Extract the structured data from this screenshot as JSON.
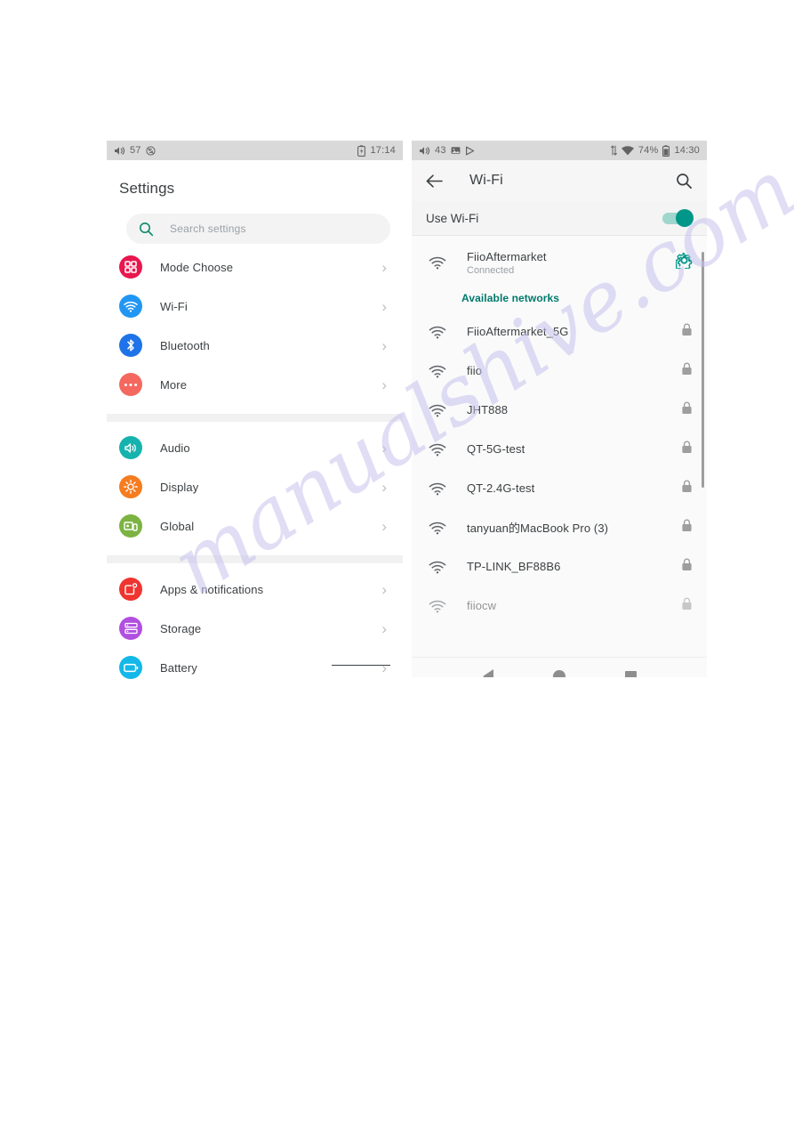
{
  "watermark": {
    "text": "manualshive.com"
  },
  "left_phone": {
    "status_bar": {
      "volume_icon": "volume-icon",
      "volume_value": "57",
      "sync_disabled_icon": "sync-disabled-icon",
      "battery_icon": "battery-charging-icon",
      "time": "17:14"
    },
    "page_title": "Settings",
    "search": {
      "placeholder": "Search settings",
      "icon": "search-icon"
    },
    "groups": [
      {
        "items": [
          {
            "label": "Mode Choose",
            "icon": "grid-icon",
            "color": "#E8174E"
          },
          {
            "label": "Wi-Fi",
            "icon": "wifi-icon",
            "color": "#2196F3"
          },
          {
            "label": "Bluetooth",
            "icon": "bluetooth-icon",
            "color": "#1E73E8"
          },
          {
            "label": "More",
            "icon": "more-dots-icon",
            "color": "#F4685F"
          }
        ]
      },
      {
        "items": [
          {
            "label": "Audio",
            "icon": "speaker-icon",
            "color": "#16B3AE"
          },
          {
            "label": "Display",
            "icon": "brightness-icon",
            "color": "#F57C20"
          },
          {
            "label": "Global",
            "icon": "devices-icon",
            "color": "#7CB342"
          }
        ]
      },
      {
        "items": [
          {
            "label": "Apps & notifications",
            "icon": "apps-notifications-icon",
            "color": "#F0342F"
          },
          {
            "label": "Storage",
            "icon": "storage-icon",
            "color": "#B14FE0"
          },
          {
            "label": "Battery",
            "icon": "battery-icon",
            "color": "#14B8E8"
          }
        ]
      }
    ],
    "chevron": "›"
  },
  "right_phone": {
    "status_bar": {
      "volume_icon": "volume-icon",
      "volume_value": "43",
      "image_icon": "image-icon",
      "play_icon": "play-icon",
      "data_arrows_icon": "data-transfer-icon",
      "wifi_icon": "wifi-icon",
      "battery_percent": "74%",
      "battery_icon": "battery-icon",
      "time": "14:30"
    },
    "appbar": {
      "back_icon": "back-arrow-icon",
      "title": "Wi-Fi",
      "search_icon": "search-icon"
    },
    "use_wifi": {
      "label": "Use Wi-Fi",
      "enabled": true
    },
    "connected_network": {
      "name": "FiioAftermarket",
      "status": "Connected",
      "gear_icon": "gear-icon",
      "wifi_icon": "wifi-icon"
    },
    "available_header": "Available networks",
    "networks": [
      {
        "name": "FiioAftermarket_5G",
        "secured": true
      },
      {
        "name": "fiio",
        "secured": true
      },
      {
        "name": "JHT888",
        "secured": true
      },
      {
        "name": "QT-5G-test",
        "secured": true
      },
      {
        "name": "QT-2.4G-test",
        "secured": true
      },
      {
        "name": "tanyuan的MacBook Pro (3)",
        "secured": true
      },
      {
        "name": "TP-LINK_BF88B6",
        "secured": true
      },
      {
        "name": "fiiocw",
        "secured": true
      }
    ],
    "navbar": {
      "back": "back-triangle-icon",
      "home": "home-circle-icon",
      "recents": "recents-square-icon"
    }
  },
  "colors": {
    "accent_teal": "#009688",
    "accent_teal_dark": "#00796b",
    "status_bar_bg": "#d9d9d9",
    "text_primary": "#3c4043",
    "text_secondary": "#9aa0a6"
  }
}
